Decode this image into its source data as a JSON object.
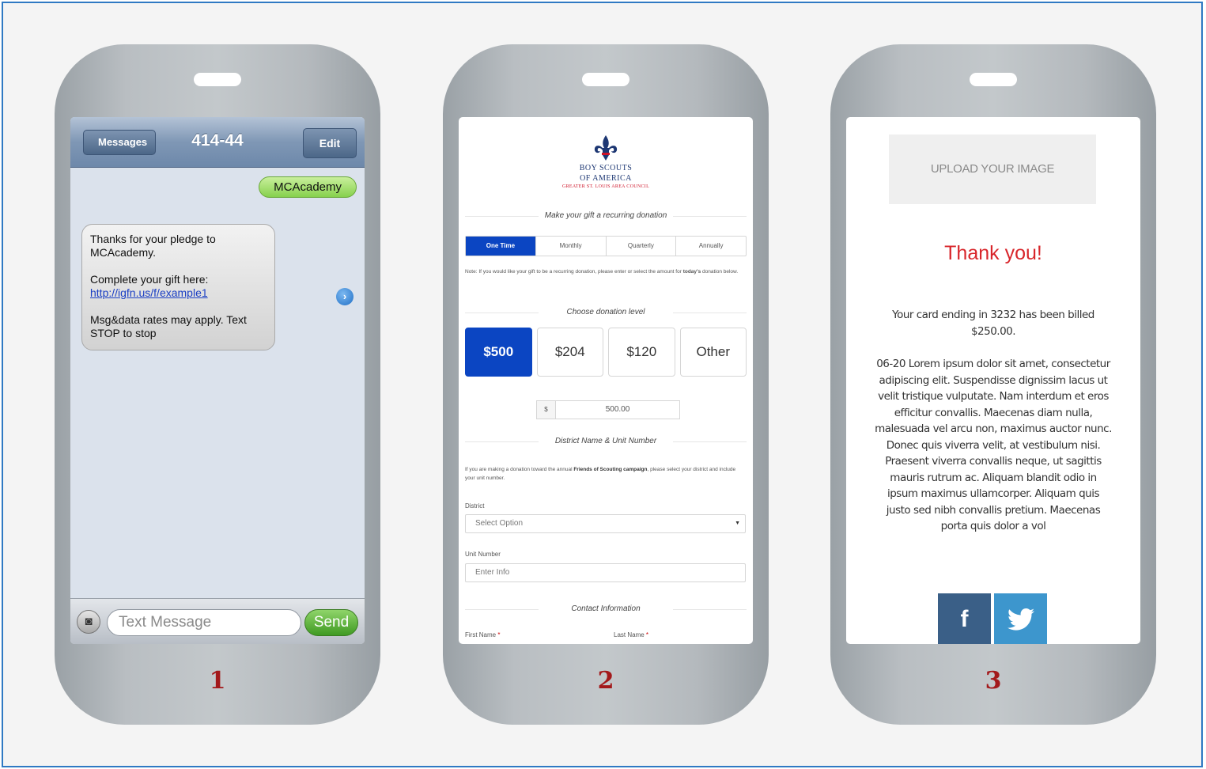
{
  "phones": [
    {
      "number": "1",
      "sms": {
        "back_label": "Messages",
        "title": "414-44",
        "edit_label": "Edit",
        "outgoing": "MCAcademy",
        "incoming": {
          "line1": "Thanks for your pledge to MCAcademy.",
          "line2": "Complete your gift here:",
          "link": "http://igfn.us/f/example1",
          "line3": "Msg&data rates may apply. Text STOP to stop"
        },
        "input_placeholder": "Text Message",
        "send_label": "Send"
      }
    },
    {
      "number": "2",
      "form": {
        "logo_line1": "BOY SCOUTS",
        "logo_line2": "OF AMERICA",
        "logo_line3": "GREATER ST. LOUIS AREA COUNCIL",
        "recurring_heading": "Make your gift a recurring donation",
        "frequencies": [
          "One Time",
          "Monthly",
          "Quarterly",
          "Annually"
        ],
        "note_prefix": "Note:  If you would like your gift to be a recurring donation, please enter or select the amount for ",
        "note_bold": "today's",
        "note_suffix": " donation below.",
        "level_heading": "Choose donation level",
        "amounts": [
          "$500",
          "$204",
          "$120",
          "Other"
        ],
        "currency_symbol": "$",
        "amount_value": "500.00",
        "district_heading": "District Name & Unit Number",
        "district_para_prefix": "If you are making a donation toward the annual ",
        "district_para_bold": "Friends of Scouting campaign",
        "district_para_suffix": ", please select your district and include your unit number.",
        "district_label": "District",
        "district_select": "Select Option",
        "unit_label": "Unit Number",
        "unit_placeholder": "Enter Info",
        "contact_heading": "Contact Information",
        "first_name_label": "First Name",
        "last_name_label": "Last Name",
        "required_mark": "*"
      }
    },
    {
      "number": "3",
      "thankyou": {
        "upload_label": "UPLOAD YOUR IMAGE",
        "heading": "Thank you!",
        "billed": "Your card ending in 3232 has been billed $250.00.",
        "body": "06-20 Lorem ipsum dolor sit amet, consectetur adipiscing elit. Suspendisse dignissim lacus ut velit tristique vulputate. Nam interdum et eros efficitur convallis. Maecenas diam nulla, malesuada vel arcu non, maximus auctor nunc. Donec quis viverra velit, at vestibulum nisi. Praesent viverra convallis neque, ut sagittis mauris rutrum ac. Aliquam blandit odio in ipsum maximus ullamcorper. Aliquam quis justo sed nibh convallis pretium. Maecenas porta quis dolor a vol",
        "facebook_glyph": "f"
      }
    }
  ],
  "colors": {
    "border_accent": "#2f79c3",
    "step_number": "#a3191b",
    "form_primary": "#0b45c2",
    "thankyou_red": "#d8262b"
  }
}
